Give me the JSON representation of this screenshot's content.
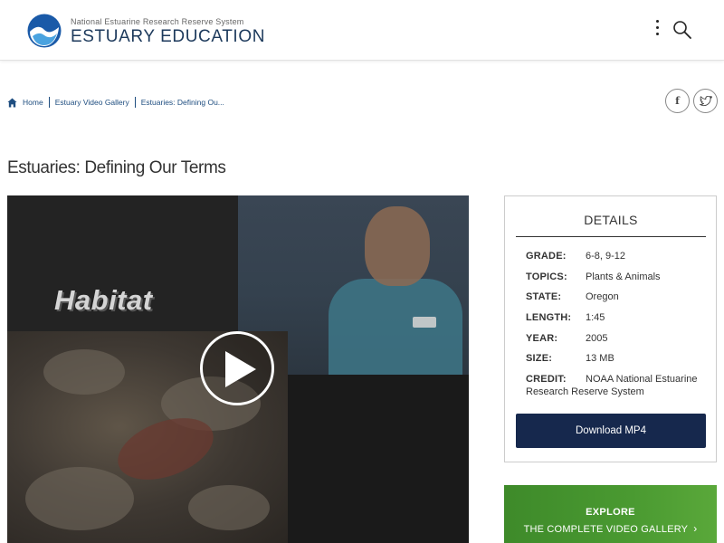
{
  "header": {
    "site_subtitle": "National Estuarine Research Reserve System",
    "site_title": "ESTUARY EDUCATION",
    "logo_icon": "noaa-logo",
    "menu_icon": "kebab-menu-icon",
    "search_icon": "search-icon"
  },
  "breadcrumb": {
    "items": [
      "Home",
      "Estuary Video Gallery",
      "Estuaries: Defining Ou..."
    ]
  },
  "social": {
    "facebook_glyph": "f",
    "facebook_icon": "facebook-icon",
    "twitter_icon": "twitter-icon"
  },
  "page": {
    "title": "Estuaries: Defining Our Terms"
  },
  "video": {
    "overlay_text": "Habitat",
    "play_icon": "play-icon"
  },
  "details": {
    "title": "DETAILS",
    "rows": [
      {
        "key": "GRADE:",
        "value": "6-8, 9-12"
      },
      {
        "key": "TOPICS:",
        "value": "Plants & Animals"
      },
      {
        "key": "STATE:",
        "value": "Oregon"
      },
      {
        "key": "LENGTH:",
        "value": "1:45"
      },
      {
        "key": "YEAR:",
        "value": "2005"
      },
      {
        "key": "SIZE:",
        "value": "13 MB"
      }
    ],
    "credit": {
      "key": "CREDIT:",
      "value_line1": "NOAA National Estuarine",
      "value_line2": "Research Reserve System"
    },
    "download_label": "Download MP4"
  },
  "explore": {
    "line1": "EXPLORE",
    "line2": "THE COMPLETE VIDEO GALLERY",
    "chevron": "›"
  },
  "colors": {
    "navy": "#16284d",
    "link_blue": "#1f4e80",
    "green": "#4a9a31"
  }
}
